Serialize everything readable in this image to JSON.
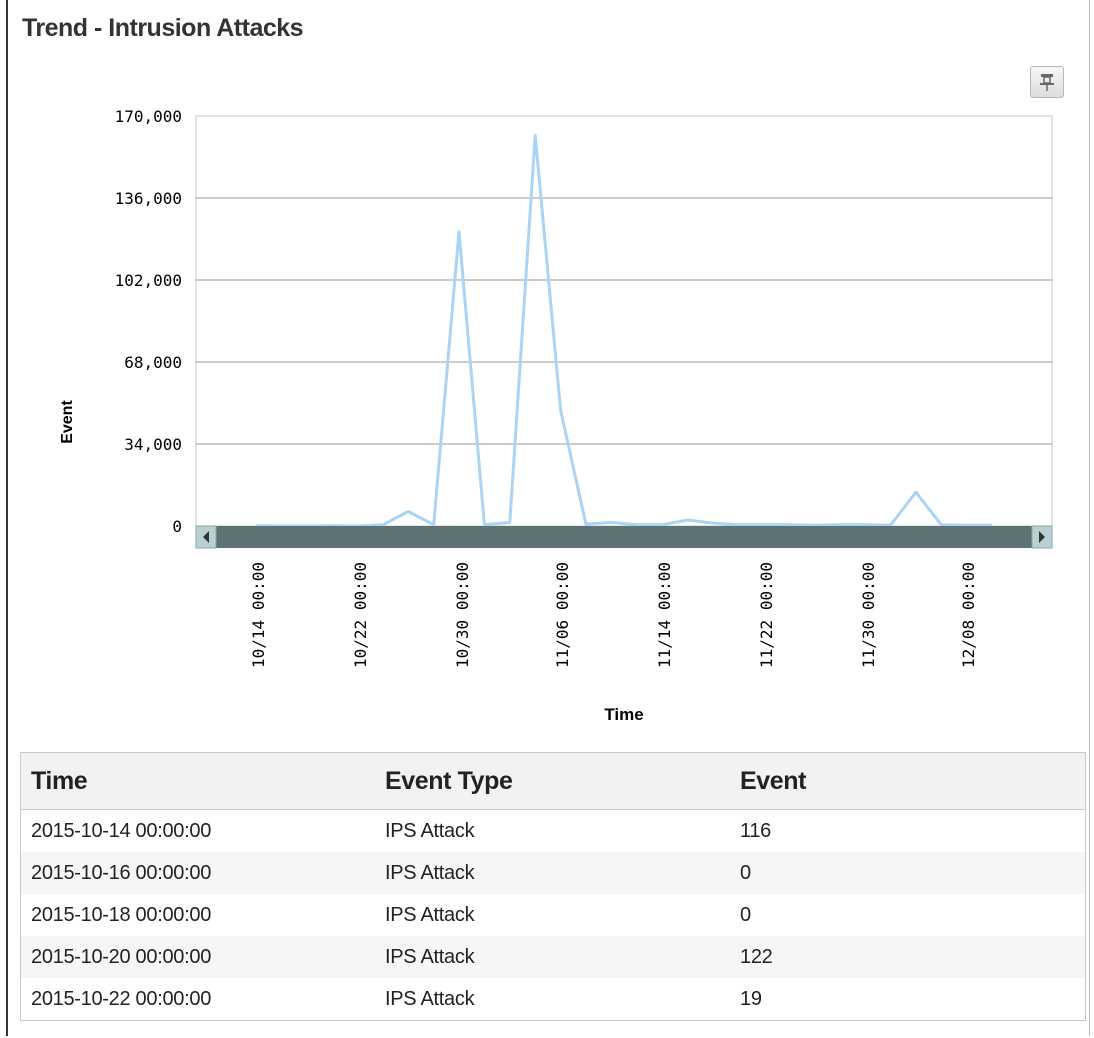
{
  "panel": {
    "title": "Trend - Intrusion Attacks",
    "pin_icon": "pin-icon"
  },
  "chart_data": {
    "type": "line",
    "title": "",
    "xlabel": "Time",
    "ylabel": "Event",
    "ylim": [
      0,
      170000
    ],
    "yticks": [
      "170,000",
      "136,000",
      "102,000",
      "68,000",
      "34,000",
      "0"
    ],
    "xticks": [
      "10/14 00:00",
      "10/22 00:00",
      "10/30 00:00",
      "11/06 00:00",
      "11/14 00:00",
      "11/22 00:00",
      "11/30 00:00",
      "12/08 00:00"
    ],
    "grid": true,
    "line_color": "#a9d4f5",
    "series": [
      {
        "name": "",
        "x": [
          "10/14",
          "10/16",
          "10/18",
          "10/20",
          "10/22",
          "10/24",
          "10/26",
          "10/28",
          "10/30",
          "11/01",
          "11/03",
          "11/05",
          "11/07",
          "11/09",
          "11/11",
          "11/13",
          "11/15",
          "11/17",
          "11/19",
          "11/21",
          "11/23",
          "11/25",
          "11/27",
          "11/29",
          "12/01",
          "12/03",
          "12/05",
          "12/07",
          "12/09",
          "12/11"
        ],
        "values": [
          116,
          0,
          0,
          122,
          19,
          500,
          6000,
          500,
          122000,
          500,
          1500,
          162000,
          48000,
          800,
          1500,
          500,
          500,
          2500,
          1200,
          500,
          500,
          500,
          300,
          500,
          500,
          300,
          14000,
          500,
          300,
          300
        ]
      }
    ],
    "scrollbar": {
      "left_arrow": "left-arrow-icon",
      "right_arrow": "right-arrow-icon"
    }
  },
  "table": {
    "headers": [
      "Time",
      "Event Type",
      "Event"
    ],
    "rows": [
      [
        "2015-10-14 00:00:00",
        "IPS Attack",
        "116"
      ],
      [
        "2015-10-16 00:00:00",
        "IPS Attack",
        "0"
      ],
      [
        "2015-10-18 00:00:00",
        "IPS Attack",
        "0"
      ],
      [
        "2015-10-20 00:00:00",
        "IPS Attack",
        "122"
      ],
      [
        "2015-10-22 00:00:00",
        "IPS Attack",
        "19"
      ]
    ]
  }
}
